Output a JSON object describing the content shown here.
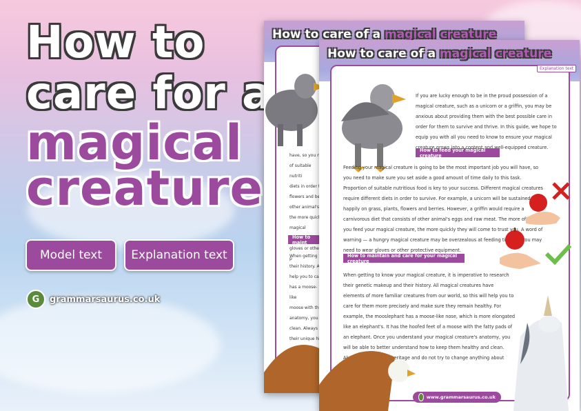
{
  "page": {
    "title_line1": "How to",
    "title_line2": "care for a",
    "title_line3": "magical",
    "title_line4": "creature"
  },
  "buttons": {
    "model": "Model text",
    "explanation": "Explanation text"
  },
  "brand": {
    "badge": "G",
    "site": "grammarsaurus.co.uk"
  },
  "back_sheet": {
    "title_plain": "How to care of a ",
    "title_highlight": "magical creature",
    "text_lines": [
      "have, so you ne",
      "of suitable nutriti",
      "diets in order to",
      "flowers and berr",
      "other animal's e",
      "the more quickl",
      "magical creature",
      "gloves or other p"
    ],
    "section_head": "How to maint",
    "text_lines_2": [
      "When getting to",
      "their history. All",
      "help you to care",
      "has a moose-like",
      "moose with the",
      "anatomy, you w",
      "clean. Always r",
      "their unique hist"
    ]
  },
  "front_sheet": {
    "title_plain": "How to care of a ",
    "title_highlight": "magical creature",
    "tag": "Explanation text",
    "para1": "If you are lucky enough to be in the proud possession of a magical creature, such as a unicorn or a griffin, you may be anxious about providing them with the best possible care in order for them to survive and thrive. In this guide, we hope to equip you with all you need to know to ensure your magical creature grows into a content and well-equipped creature.",
    "section1": "How to feed your magical creature",
    "para2": "Feeding your magical creature is going to be the most important job you will have, so you need to make sure you set aside a good amount of time daily to this task. Proportion of suitable nutritious food is key to your success. Different magical creatures require different diets in order to survive. For example, a unicorn will be sustained happily on grass, plants, flowers and berries. However, a griffin would require a carnivorous diet that consists of other animal's eggs and raw meat. The more often you feed your magical creature, the more quickly they will come to trust you. A word of warning — a hungry magical creature may be overzealous at feeding time, so you may need to wear gloves or other protective equipment.",
    "section2": "How to maintain and care for your magical creature",
    "para3": "When getting to know your magical creature, it is imperative to research their genetic makeup and their history. All magical creatures have elements of more familiar creatures from our world, so this will help you to care for them more precisely and make sure they remain healthy. For example, the mooslephant has a moose-like nose, which is more elongated like an elephant's. It has the hoofed feet of a moose with the fatty pads of an elephant. Once you understand your magical creature's anatomy, you will be able to better understand how to keep them healthy and clean. Always respect their heritage and do not try to change anything about their unique history.",
    "footer": "www.grammarsaurus.co.uk"
  },
  "colors": {
    "accent": "#9c4a9e",
    "brand_green": "#5b8a3c"
  }
}
